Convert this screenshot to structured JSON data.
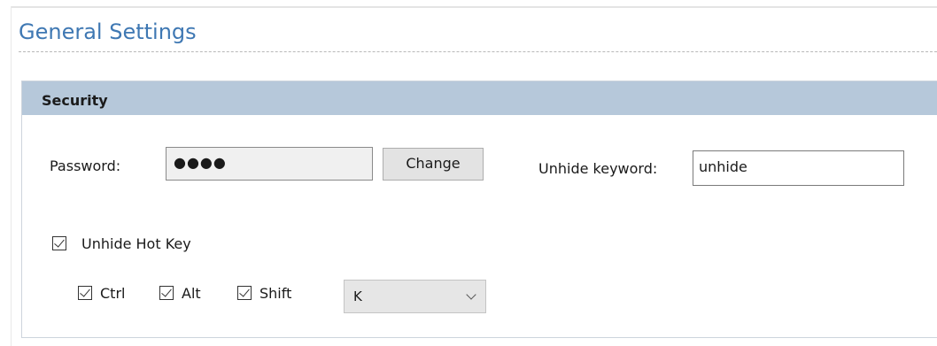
{
  "page": {
    "title": "General Settings"
  },
  "security": {
    "header": "Security",
    "password_label": "Password:",
    "password_value": "●●●●",
    "change_label": "Change",
    "keyword_label": "Unhide keyword:",
    "keyword_value": "unhide"
  },
  "hotkey": {
    "label": "Unhide Hot Key",
    "enabled": true,
    "modifiers": [
      {
        "label": "Ctrl",
        "checked": true
      },
      {
        "label": "Alt",
        "checked": true
      },
      {
        "label": "Shift",
        "checked": true
      }
    ],
    "key_value": "K"
  },
  "colors": {
    "title": "#3f78b3",
    "section_header_bg": "#b6c8da"
  }
}
